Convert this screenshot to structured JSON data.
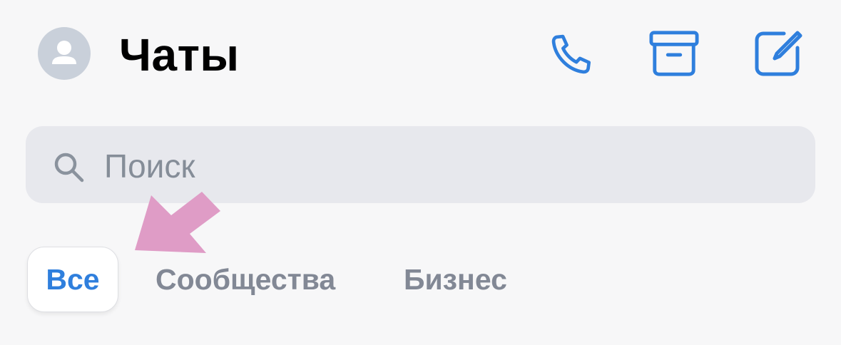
{
  "header": {
    "title": "Чаты",
    "avatar_icon": "user-avatar-icon",
    "actions": [
      {
        "name": "calls",
        "icon": "phone-icon"
      },
      {
        "name": "archive",
        "icon": "archive-box-icon"
      },
      {
        "name": "new-chat",
        "icon": "compose-icon"
      }
    ]
  },
  "search": {
    "placeholder": "Поиск",
    "icon": "search-icon"
  },
  "filters": {
    "tabs": [
      {
        "label": "Все",
        "active": true
      },
      {
        "label": "Сообщества",
        "active": false
      },
      {
        "label": "Бизнес",
        "active": false
      }
    ]
  },
  "annotation": {
    "icon": "pointer-arrow",
    "color": "#df9cc6"
  },
  "colors": {
    "accent": "#2f7fdd",
    "background": "#f7f7f8",
    "search_background": "#e7e8ed",
    "inactive_text": "#828895",
    "avatar_background": "#c9d0da"
  }
}
